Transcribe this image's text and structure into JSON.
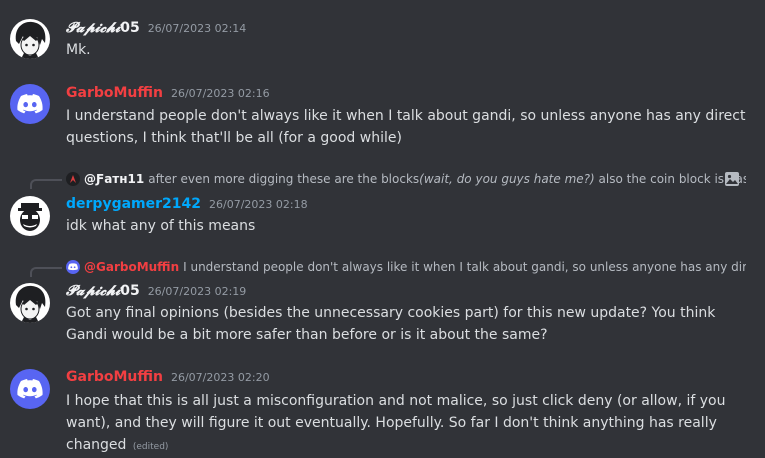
{
  "messages": [
    {
      "username_first": "𝓟𝓪𝓹𝓲𝓬𝓱𝓲",
      "username_rest": "05",
      "timestamp": "26/07/2023 02:14",
      "content": "Mk."
    },
    {
      "username": "GarboMuffin",
      "timestamp": "26/07/2023 02:16",
      "content": "I understand people don't always like it when I talk about gandi, so unless anyone has any direct questions, I think that'll be all (for a good while)"
    },
    {
      "reply": {
        "name": "@Ƒатн11",
        "text_before": "after even more digging these are the blocks",
        "text_italic": "(wait, do you guys hate me?)",
        "text_after": " also the coin block is bas"
      },
      "username": "derpygamer2142",
      "timestamp": "26/07/2023 02:18",
      "content": "idk what any of this means"
    },
    {
      "reply": {
        "name": "@GarboMuffin",
        "text": "I understand people don't always like it when I talk about gandi, so unless anyone has any direct"
      },
      "username_first": "𝓟𝓪𝓹𝓲𝓬𝓱𝓲",
      "username_rest": "05",
      "timestamp": "26/07/2023 02:19",
      "content": "Got any final opinions (besides the unnecessary cookies part) for this new update? You think Gandi would be a bit more safer than before or is it about the same?"
    },
    {
      "username": "GarboMuffin",
      "timestamp": "26/07/2023 02:20",
      "content": "I hope that this is all just a misconfiguration and not malice, so just click deny (or allow, if you want), and they will figure it out eventually. Hopefully. So far I don't think anything has really changed",
      "edited": "(edited)"
    }
  ],
  "colors": {
    "background": "#313338",
    "discord_blurple": "#5865f2",
    "name_red": "#f23f42",
    "name_blue": "#00a8fc"
  }
}
